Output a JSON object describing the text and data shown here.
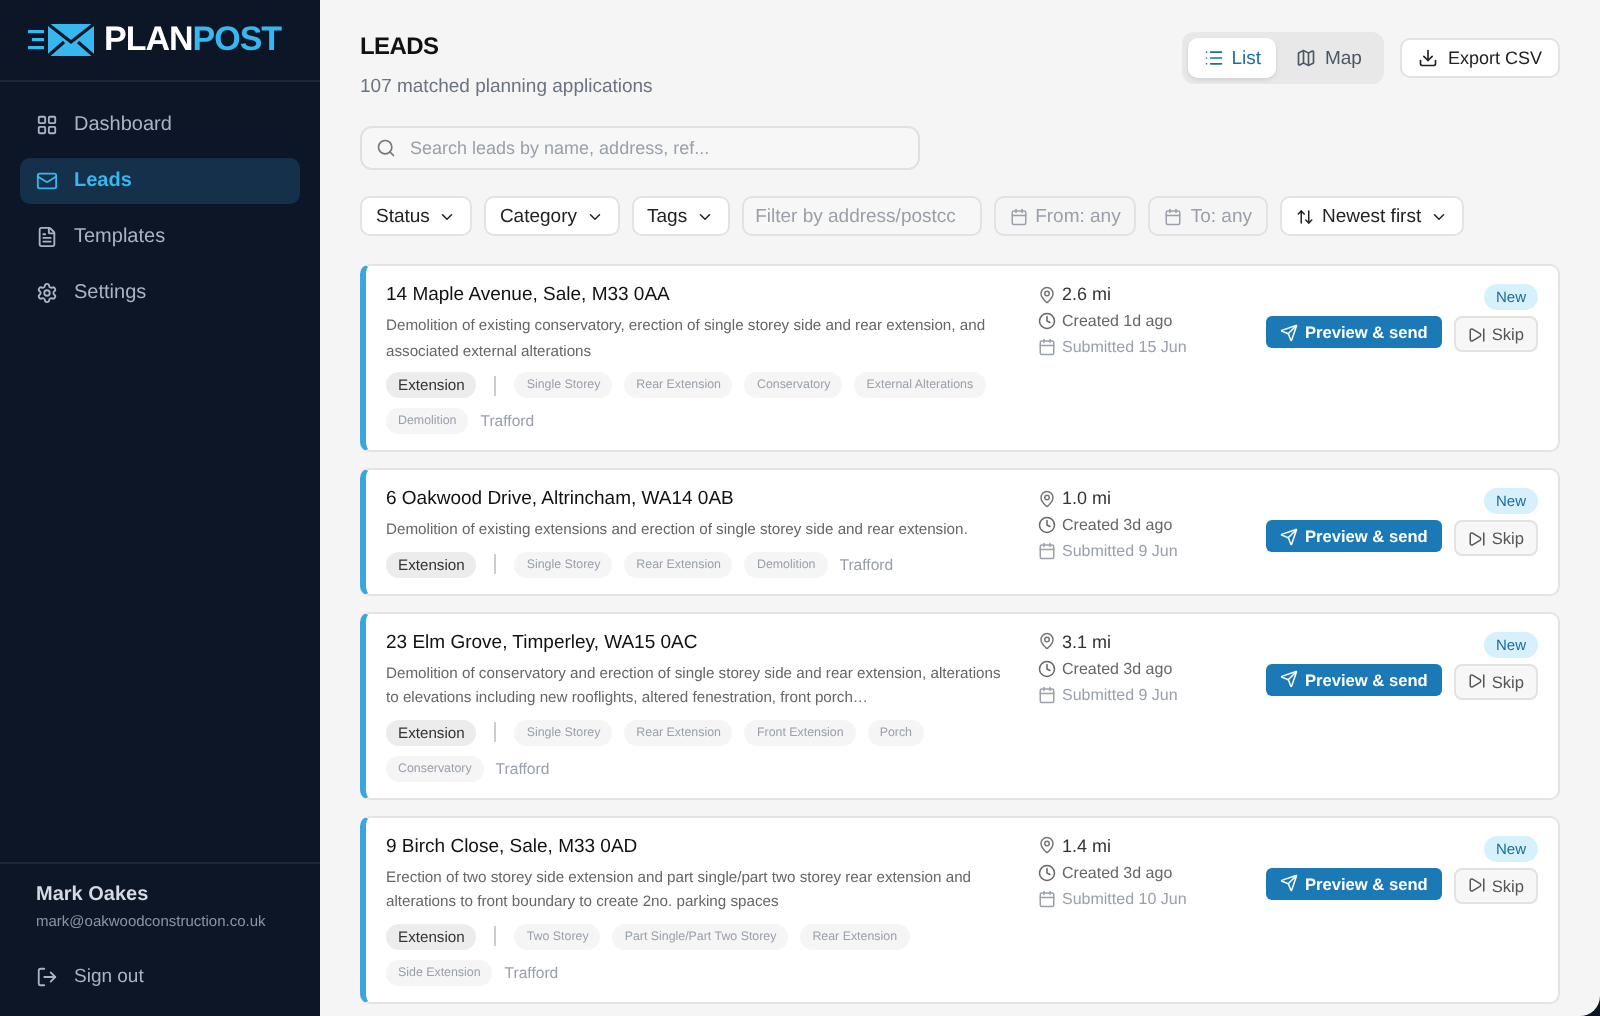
{
  "sidebar": {
    "logo": {
      "first": "PLAN",
      "second": "POST"
    },
    "items": [
      {
        "label": "Dashboard",
        "selected": false
      },
      {
        "label": "Leads",
        "selected": true
      },
      {
        "label": "Templates",
        "selected": false
      },
      {
        "label": "Settings",
        "selected": false
      }
    ],
    "user": {
      "name": "Mark Oakes",
      "email": "mark@oakwoodconstruction.co.uk"
    },
    "sign_out": "Sign out"
  },
  "header": {
    "title": "LEADS",
    "subtitle": "107 matched planning applications",
    "views": [
      {
        "label": "List",
        "selected": true
      },
      {
        "label": "Map",
        "selected": false
      }
    ],
    "export": "Export CSV"
  },
  "search": {
    "placeholder": "Search leads by name, address, ref..."
  },
  "filters": [
    {
      "kind": "dropdown",
      "label": "Status"
    },
    {
      "kind": "dropdown",
      "label": "Category"
    },
    {
      "kind": "dropdown",
      "label": "Tags"
    },
    {
      "kind": "input",
      "placeholder": "Filter by address/postcc"
    },
    {
      "kind": "date",
      "label": "From: any"
    },
    {
      "kind": "date",
      "label": "To: any"
    },
    {
      "kind": "sort",
      "label": "Newest first"
    }
  ],
  "leads": [
    {
      "address": "14 Maple Avenue, Sale, M33 0AA",
      "description": "Demolition of existing conservatory, erection of single storey side and rear extension, and associated external alterations",
      "category": "Extension",
      "tags": [
        "Single Storey",
        "Rear Extension",
        "Conservatory",
        "External Alterations",
        "Demolition"
      ],
      "area": "Trafford",
      "distance": "2.6 mi",
      "created": "Created 1d ago",
      "submitted": "Submitted 15 Jun",
      "status": "New",
      "primary": "Preview & send",
      "secondary": "Skip"
    },
    {
      "address": "6 Oakwood Drive, Altrincham, WA14 0AB",
      "description": "Demolition of existing extensions and erection of single storey side and rear extension.",
      "category": "Extension",
      "tags": [
        "Single Storey",
        "Rear Extension",
        "Demolition"
      ],
      "area": "Trafford",
      "distance": "1.0 mi",
      "created": "Created 3d ago",
      "submitted": "Submitted 9 Jun",
      "status": "New",
      "primary": "Preview & send",
      "secondary": "Skip"
    },
    {
      "address": "23 Elm Grove, Timperley, WA15 0AC",
      "description": "Demolition of conservatory and erection of single storey side and rear extension, alterations to elevations including new rooflights, altered fenestration, front porch…",
      "category": "Extension",
      "tags": [
        "Single Storey",
        "Rear Extension",
        "Front Extension",
        "Porch",
        "Conservatory"
      ],
      "area": "Trafford",
      "distance": "3.1 mi",
      "created": "Created 3d ago",
      "submitted": "Submitted 9 Jun",
      "status": "New",
      "primary": "Preview & send",
      "secondary": "Skip"
    },
    {
      "address": "9 Birch Close, Sale, M33 0AD",
      "description": "Erection of two storey side extension and part single/part two storey rear extension and alterations to front boundary to create 2no. parking spaces",
      "category": "Extension",
      "tags": [
        "Two Storey",
        "Part Single/Part Two Storey",
        "Rear Extension",
        "Side Extension"
      ],
      "area": "Trafford",
      "distance": "1.4 mi",
      "created": "Created 3d ago",
      "submitted": "Submitted 10 Jun",
      "status": "New",
      "primary": "Preview & send",
      "secondary": "Skip"
    }
  ]
}
